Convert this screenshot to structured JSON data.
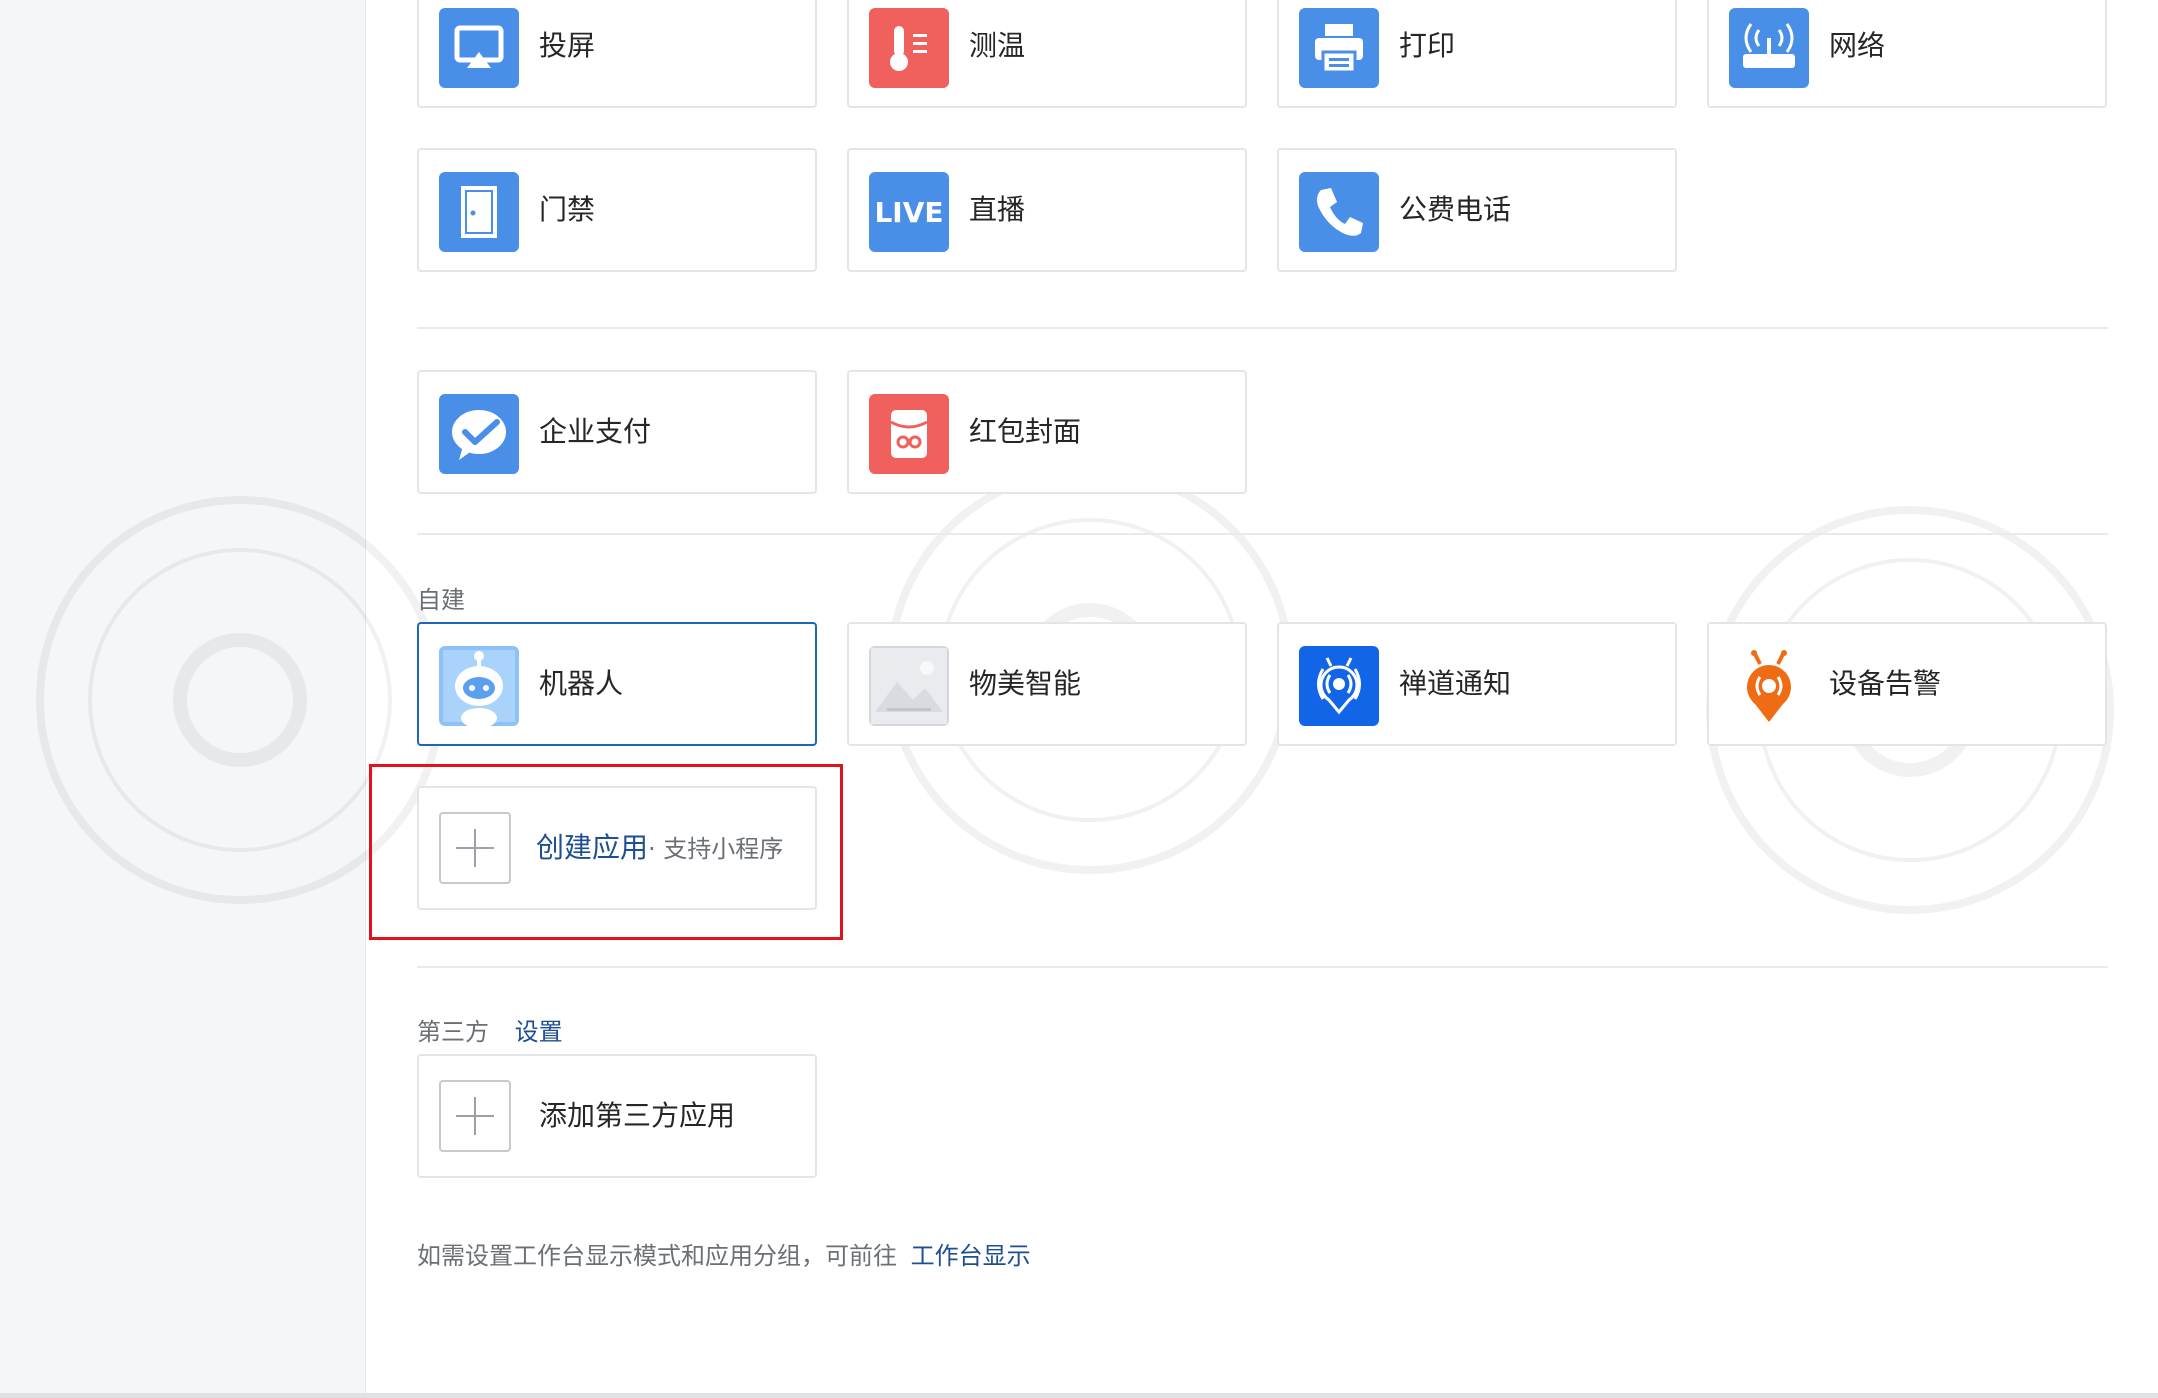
{
  "icons": {
    "screen_cast": "screen-cast-icon",
    "thermometer": "thermometer-icon",
    "printer": "printer-icon",
    "router": "router-icon",
    "door": "door-icon",
    "live": "live-icon",
    "phone": "phone-icon",
    "wechat_pay": "wechat-pay-icon",
    "red_envelope": "red-envelope-icon",
    "robot": "robot-icon",
    "image_placeholder": "image-placeholder-icon",
    "broadcast_drop": "broadcast-drop-icon",
    "alarm_drop": "alarm-drop-icon",
    "plus": "plus-icon"
  },
  "colors": {
    "icon_blue": "#4a8fe7",
    "icon_red": "#f0605d",
    "chandao_blue": "#1365e8",
    "alarm_orange": "#ef6c15",
    "link_blue": "#1d4f91",
    "highlight_red": "#e0121b"
  },
  "tools": {
    "items": [
      {
        "label": "投屏"
      },
      {
        "label": "测温"
      },
      {
        "label": "打印"
      },
      {
        "label": "网络"
      },
      {
        "label": "门禁"
      },
      {
        "label": "直播",
        "icon_text": "LIVE"
      },
      {
        "label": "公费电话"
      }
    ]
  },
  "payments": {
    "items": [
      {
        "label": "企业支付"
      },
      {
        "label": "红包封面"
      }
    ]
  },
  "self_built": {
    "section_label": "自建",
    "items": [
      {
        "label": "机器人"
      },
      {
        "label": "物美智能"
      },
      {
        "label": "禅道通知"
      },
      {
        "label": "设备告警"
      }
    ],
    "create_app_label": "创建应用",
    "create_app_hint": "· 支持小程序"
  },
  "third_party": {
    "section_label": "第三方",
    "settings_link": "设置",
    "add_label": "添加第三方应用"
  },
  "footer": {
    "text": "如需设置工作台显示模式和应用分组，可前往",
    "link": "工作台显示"
  }
}
